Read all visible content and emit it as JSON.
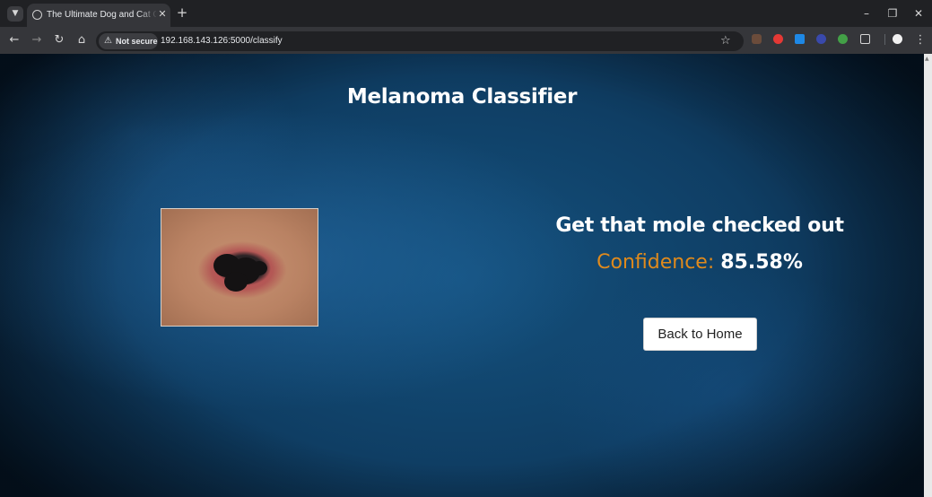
{
  "browser": {
    "tab_title": "The Ultimate Dog and Cat Classifier",
    "security_label": "Not secure",
    "url": "192.168.143.126:5000/classify",
    "icons": {
      "tab_menu": "chevron-down-icon",
      "new_tab": "plus-icon",
      "back": "arrow-left-icon",
      "forward": "arrow-right-icon",
      "reload": "reload-icon",
      "home": "home-icon",
      "bookmark": "star-icon",
      "extensions": "puzzle-icon",
      "menu": "kebab-icon"
    },
    "extension_colors": [
      "#6b4c3b",
      "#e53935",
      "#1e88e5",
      "#3949ab",
      "#43a047",
      "#ffffff"
    ]
  },
  "page": {
    "title": "Melanoma Classifier",
    "result_heading": "Get that mole checked out",
    "confidence_label": "Confidence:",
    "confidence_value": "85.58%",
    "back_button": "Back to Home",
    "accent_color": "#e08a1c",
    "background_color": "#0f3e64"
  }
}
